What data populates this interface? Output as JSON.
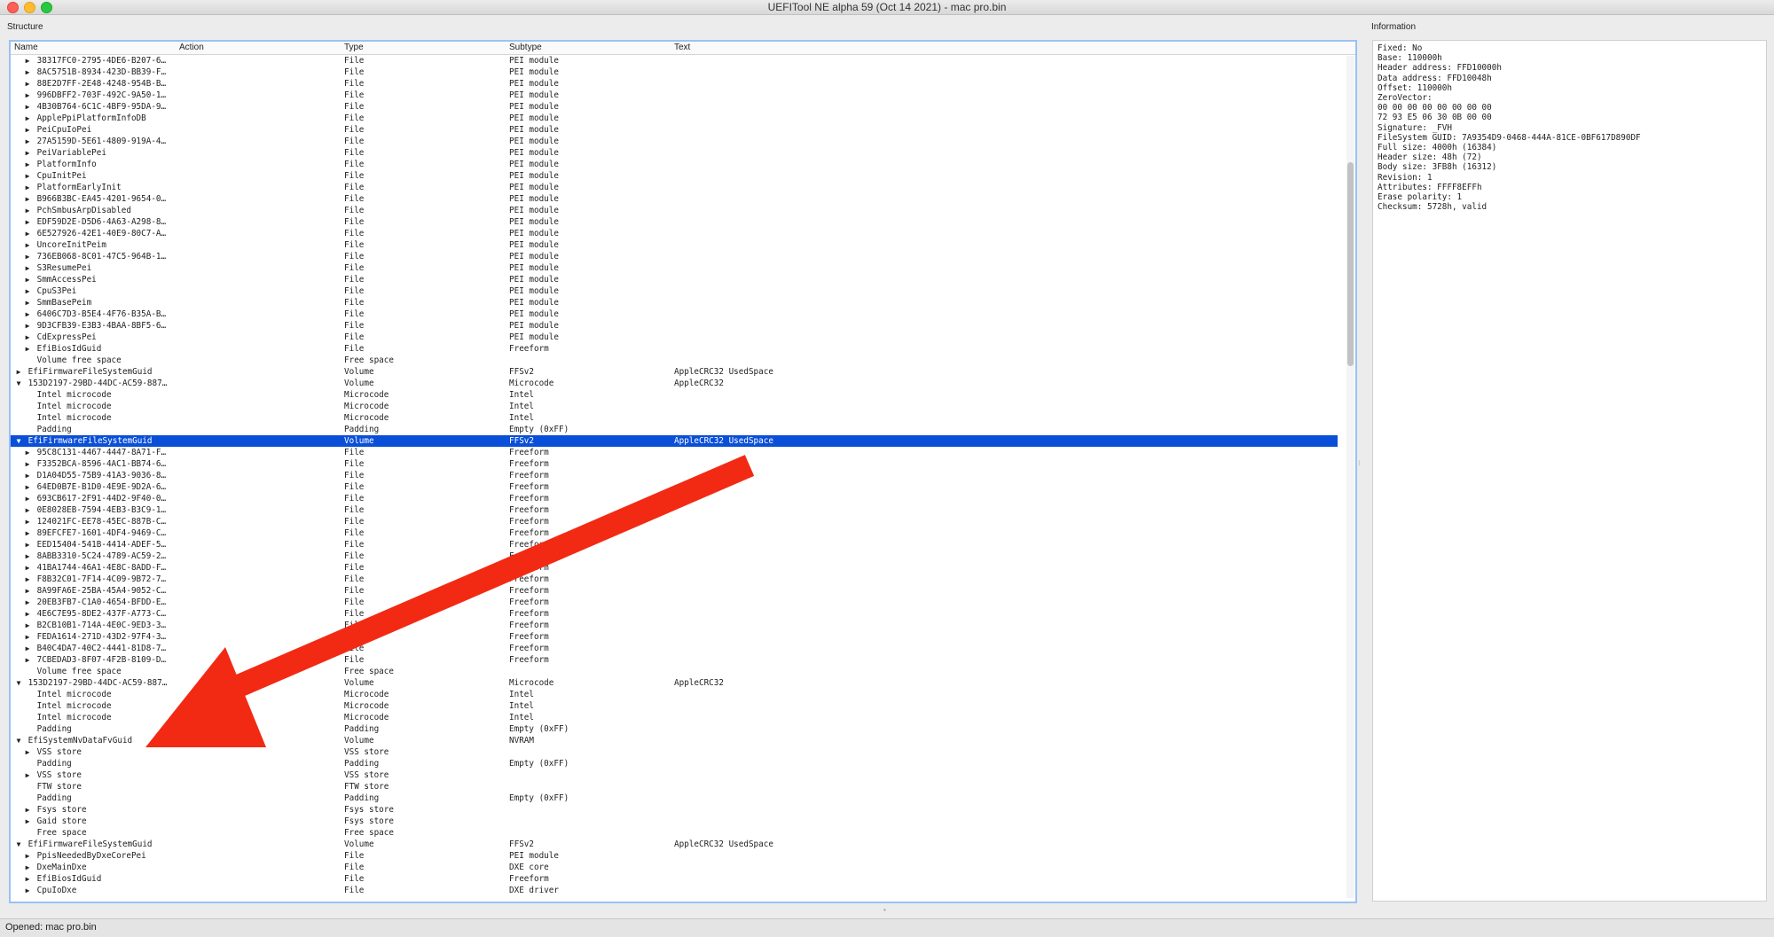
{
  "window": {
    "title": "UEFITool NE alpha 59 (Oct 14 2021) - mac pro.bin"
  },
  "panels": {
    "structure": "Structure",
    "information": "Information"
  },
  "columns": {
    "name": "Name",
    "action": "Action",
    "type": "Type",
    "subtype": "Subtype",
    "text": "Text"
  },
  "rows": [
    {
      "n": "38317FC0-2795-4DE6-B207-6…",
      "t": "File",
      "s": "PEI module",
      "x": "",
      "i": 2,
      "a": "c"
    },
    {
      "n": "8AC5751B-8934-423D-BB39-F…",
      "t": "File",
      "s": "PEI module",
      "x": "",
      "i": 2,
      "a": "c"
    },
    {
      "n": "88E2D7FF-2E48-4248-954B-B…",
      "t": "File",
      "s": "PEI module",
      "x": "",
      "i": 2,
      "a": "c"
    },
    {
      "n": "996DBFF2-703F-492C-9A50-1…",
      "t": "File",
      "s": "PEI module",
      "x": "",
      "i": 2,
      "a": "c"
    },
    {
      "n": "4B30B764-6C1C-4BF9-95DA-9…",
      "t": "File",
      "s": "PEI module",
      "x": "",
      "i": 2,
      "a": "c"
    },
    {
      "n": "ApplePpiPlatformInfoDB",
      "t": "File",
      "s": "PEI module",
      "x": "",
      "i": 2,
      "a": "c"
    },
    {
      "n": "PeiCpuIoPei",
      "t": "File",
      "s": "PEI module",
      "x": "",
      "i": 2,
      "a": "c"
    },
    {
      "n": "27A5159D-5E61-4809-919A-4…",
      "t": "File",
      "s": "PEI module",
      "x": "",
      "i": 2,
      "a": "c"
    },
    {
      "n": "PeiVariablePei",
      "t": "File",
      "s": "PEI module",
      "x": "",
      "i": 2,
      "a": "c"
    },
    {
      "n": "PlatformInfo",
      "t": "File",
      "s": "PEI module",
      "x": "",
      "i": 2,
      "a": "c"
    },
    {
      "n": "CpuInitPei",
      "t": "File",
      "s": "PEI module",
      "x": "",
      "i": 2,
      "a": "c"
    },
    {
      "n": "PlatformEarlyInit",
      "t": "File",
      "s": "PEI module",
      "x": "",
      "i": 2,
      "a": "c"
    },
    {
      "n": "B966B3BC-EA45-4201-9654-0…",
      "t": "File",
      "s": "PEI module",
      "x": "",
      "i": 2,
      "a": "c"
    },
    {
      "n": "PchSmbusArpDisabled",
      "t": "File",
      "s": "PEI module",
      "x": "",
      "i": 2,
      "a": "c"
    },
    {
      "n": "EDF59D2E-D5D6-4A63-A298-8…",
      "t": "File",
      "s": "PEI module",
      "x": "",
      "i": 2,
      "a": "c"
    },
    {
      "n": "6E527926-42E1-40E9-80C7-A…",
      "t": "File",
      "s": "PEI module",
      "x": "",
      "i": 2,
      "a": "c"
    },
    {
      "n": "UncoreInitPeim",
      "t": "File",
      "s": "PEI module",
      "x": "",
      "i": 2,
      "a": "c"
    },
    {
      "n": "736EB068-8C01-47C5-964B-1…",
      "t": "File",
      "s": "PEI module",
      "x": "",
      "i": 2,
      "a": "c"
    },
    {
      "n": "S3ResumePei",
      "t": "File",
      "s": "PEI module",
      "x": "",
      "i": 2,
      "a": "c"
    },
    {
      "n": "SmmAccessPei",
      "t": "File",
      "s": "PEI module",
      "x": "",
      "i": 2,
      "a": "c"
    },
    {
      "n": "CpuS3Pei",
      "t": "File",
      "s": "PEI module",
      "x": "",
      "i": 2,
      "a": "c"
    },
    {
      "n": "SmmBasePeim",
      "t": "File",
      "s": "PEI module",
      "x": "",
      "i": 2,
      "a": "c"
    },
    {
      "n": "6406C7D3-B5E4-4F76-B35A-B…",
      "t": "File",
      "s": "PEI module",
      "x": "",
      "i": 2,
      "a": "c"
    },
    {
      "n": "9D3CFB39-E3B3-4BAA-8BF5-6…",
      "t": "File",
      "s": "PEI module",
      "x": "",
      "i": 2,
      "a": "c"
    },
    {
      "n": "CdExpressPei",
      "t": "File",
      "s": "PEI module",
      "x": "",
      "i": 2,
      "a": "c"
    },
    {
      "n": "EfiBiosIdGuid",
      "t": "File",
      "s": "Freeform",
      "x": "",
      "i": 2,
      "a": "c"
    },
    {
      "n": "Volume free space",
      "t": "Free space",
      "s": "",
      "x": "",
      "i": 2,
      "a": ""
    },
    {
      "n": "EfiFirmwareFileSystemGuid",
      "t": "Volume",
      "s": "FFSv2",
      "x": "AppleCRC32 UsedSpace",
      "i": 1,
      "a": "c"
    },
    {
      "n": "153D2197-29BD-44DC-AC59-887…",
      "t": "Volume",
      "s": "Microcode",
      "x": "AppleCRC32",
      "i": 1,
      "a": "e"
    },
    {
      "n": "Intel microcode",
      "t": "Microcode",
      "s": "Intel",
      "x": "",
      "i": 2,
      "a": ""
    },
    {
      "n": "Intel microcode",
      "t": "Microcode",
      "s": "Intel",
      "x": "",
      "i": 2,
      "a": ""
    },
    {
      "n": "Intel microcode",
      "t": "Microcode",
      "s": "Intel",
      "x": "",
      "i": 2,
      "a": ""
    },
    {
      "n": "Padding",
      "t": "Padding",
      "s": "Empty (0xFF)",
      "x": "",
      "i": 2,
      "a": ""
    },
    {
      "n": "EfiFirmwareFileSystemGuid",
      "t": "Volume",
      "s": "FFSv2",
      "x": "AppleCRC32 UsedSpace",
      "i": 1,
      "a": "e",
      "sel": true
    },
    {
      "n": "95C8C131-4467-4447-8A71-F…",
      "t": "File",
      "s": "Freeform",
      "x": "",
      "i": 2,
      "a": "c"
    },
    {
      "n": "F3352BCA-8596-4AC1-BB74-6…",
      "t": "File",
      "s": "Freeform",
      "x": "",
      "i": 2,
      "a": "c"
    },
    {
      "n": "D1A04D55-75B9-41A3-9036-8…",
      "t": "File",
      "s": "Freeform",
      "x": "",
      "i": 2,
      "a": "c"
    },
    {
      "n": "64ED0B7E-B1D0-4E9E-9D2A-6…",
      "t": "File",
      "s": "Freeform",
      "x": "",
      "i": 2,
      "a": "c"
    },
    {
      "n": "693CB617-2F91-44D2-9F40-0…",
      "t": "File",
      "s": "Freeform",
      "x": "",
      "i": 2,
      "a": "c"
    },
    {
      "n": "0E8028EB-7594-4EB3-B3C9-1…",
      "t": "File",
      "s": "Freeform",
      "x": "",
      "i": 2,
      "a": "c"
    },
    {
      "n": "124021FC-EE78-45EC-887B-C…",
      "t": "File",
      "s": "Freeform",
      "x": "",
      "i": 2,
      "a": "c"
    },
    {
      "n": "89EFCFE7-1601-4DF4-9469-C…",
      "t": "File",
      "s": "Freeform",
      "x": "",
      "i": 2,
      "a": "c"
    },
    {
      "n": "EED15404-541B-4414-ADEF-5…",
      "t": "File",
      "s": "Freeform",
      "x": "",
      "i": 2,
      "a": "c"
    },
    {
      "n": "8ABB3310-5C24-4789-AC59-2…",
      "t": "File",
      "s": "Freeform",
      "x": "",
      "i": 2,
      "a": "c"
    },
    {
      "n": "41BA1744-46A1-4E8C-8ADD-F…",
      "t": "File",
      "s": "Freeform",
      "x": "",
      "i": 2,
      "a": "c"
    },
    {
      "n": "F8B32C01-7F14-4C09-9B72-7…",
      "t": "File",
      "s": "Freeform",
      "x": "",
      "i": 2,
      "a": "c"
    },
    {
      "n": "8A99FA6E-25BA-45A4-9052-C…",
      "t": "File",
      "s": "Freeform",
      "x": "",
      "i": 2,
      "a": "c"
    },
    {
      "n": "20EB3FB7-C1A0-4654-BFDD-E…",
      "t": "File",
      "s": "Freeform",
      "x": "",
      "i": 2,
      "a": "c"
    },
    {
      "n": "4E6C7E95-8DE2-437F-A773-C…",
      "t": "File",
      "s": "Freeform",
      "x": "",
      "i": 2,
      "a": "c"
    },
    {
      "n": "B2CB10B1-714A-4E0C-9ED3-3…",
      "t": "File",
      "s": "Freeform",
      "x": "",
      "i": 2,
      "a": "c"
    },
    {
      "n": "FEDA1614-271D-43D2-97F4-3…",
      "t": "File",
      "s": "Freeform",
      "x": "",
      "i": 2,
      "a": "c"
    },
    {
      "n": "B40C4DA7-40C2-4441-81D8-7…",
      "t": "File",
      "s": "Freeform",
      "x": "",
      "i": 2,
      "a": "c"
    },
    {
      "n": "7CBEDAD3-8F07-4F2B-8109-D…",
      "t": "File",
      "s": "Freeform",
      "x": "",
      "i": 2,
      "a": "c"
    },
    {
      "n": "Volume free space",
      "t": "Free space",
      "s": "",
      "x": "",
      "i": 2,
      "a": ""
    },
    {
      "n": "153D2197-29BD-44DC-AC59-887…",
      "t": "Volume",
      "s": "Microcode",
      "x": "AppleCRC32",
      "i": 1,
      "a": "e"
    },
    {
      "n": "Intel microcode",
      "t": "Microcode",
      "s": "Intel",
      "x": "",
      "i": 2,
      "a": ""
    },
    {
      "n": "Intel microcode",
      "t": "Microcode",
      "s": "Intel",
      "x": "",
      "i": 2,
      "a": ""
    },
    {
      "n": "Intel microcode",
      "t": "Microcode",
      "s": "Intel",
      "x": "",
      "i": 2,
      "a": ""
    },
    {
      "n": "Padding",
      "t": "Padding",
      "s": "Empty (0xFF)",
      "x": "",
      "i": 2,
      "a": ""
    },
    {
      "n": "EfiSystemNvDataFvGuid",
      "t": "Volume",
      "s": "NVRAM",
      "x": "",
      "i": 1,
      "a": "e"
    },
    {
      "n": "VSS store",
      "t": "VSS store",
      "s": "",
      "x": "",
      "i": 2,
      "a": "c"
    },
    {
      "n": "Padding",
      "t": "Padding",
      "s": "Empty (0xFF)",
      "x": "",
      "i": 2,
      "a": ""
    },
    {
      "n": "VSS store",
      "t": "VSS store",
      "s": "",
      "x": "",
      "i": 2,
      "a": "c"
    },
    {
      "n": "FTW store",
      "t": "FTW store",
      "s": "",
      "x": "",
      "i": 2,
      "a": ""
    },
    {
      "n": "Padding",
      "t": "Padding",
      "s": "Empty (0xFF)",
      "x": "",
      "i": 2,
      "a": ""
    },
    {
      "n": "Fsys store",
      "t": "Fsys store",
      "s": "",
      "x": "",
      "i": 2,
      "a": "c"
    },
    {
      "n": "Gaid store",
      "t": "Fsys store",
      "s": "",
      "x": "",
      "i": 2,
      "a": "c"
    },
    {
      "n": "Free space",
      "t": "Free space",
      "s": "",
      "x": "",
      "i": 2,
      "a": ""
    },
    {
      "n": "EfiFirmwareFileSystemGuid",
      "t": "Volume",
      "s": "FFSv2",
      "x": "AppleCRC32 UsedSpace",
      "i": 1,
      "a": "e"
    },
    {
      "n": "PpisNeededByDxeCorePei",
      "t": "File",
      "s": "PEI module",
      "x": "",
      "i": 2,
      "a": "c"
    },
    {
      "n": "DxeMainDxe",
      "t": "File",
      "s": "DXE core",
      "x": "",
      "i": 2,
      "a": "c"
    },
    {
      "n": "EfiBiosIdGuid",
      "t": "File",
      "s": "Freeform",
      "x": "",
      "i": 2,
      "a": "c"
    },
    {
      "n": "CpuIoDxe",
      "t": "File",
      "s": "DXE driver",
      "x": "",
      "i": 2,
      "a": "c"
    }
  ],
  "info": [
    "Fixed: No",
    "Base: 110000h",
    "Header address: FFD10000h",
    "Data address: FFD10048h",
    "Offset: 110000h",
    "ZeroVector:",
    "00 00 00 00 00 00 00 00",
    "72 93 E5 06 30 0B 00 00",
    "Signature: _FVH",
    "FileSystem GUID: 7A9354D9-0468-444A-81CE-0BF617D890DF",
    "Full size: 4000h (16384)",
    "Header size: 48h (72)",
    "Body size: 3FB8h (16312)",
    "Revision: 1",
    "Attributes: FFFF8EFFh",
    "Erase polarity: 1",
    "Checksum: 5728h, valid"
  ],
  "status": "Opened: mac pro.bin",
  "colors": {
    "selection": "#0a4fd7",
    "annotation_arrow": "#f22a14"
  }
}
